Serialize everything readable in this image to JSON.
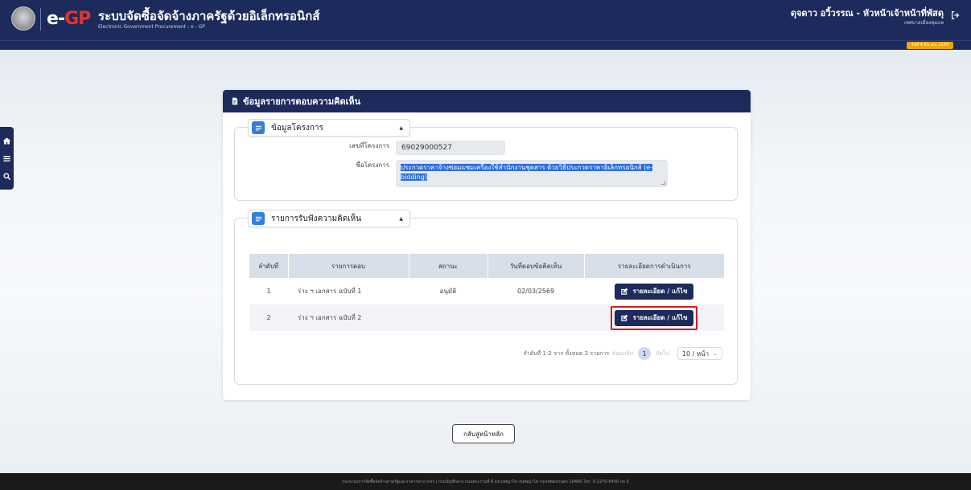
{
  "header": {
    "logo_text_e": "e-",
    "logo_text_gp": "GP",
    "system_title": "ระบบจัดซื้อจัดจ้างภาครัฐด้วยอิเล็กทรอนิกส์",
    "system_subtitle": "Electronic Government Procurement : e - GP",
    "user_name": "ดุจดาว อวิ้วรรณ - หัวหน้าเจ้าหน้าที่พัสดุ",
    "user_org": "เทศบาลเมืองชุมแพ",
    "date": "วันที่ 4 มีนาคม 2569"
  },
  "sidenav": {
    "icons": [
      "home-icon",
      "menu-icon",
      "search-icon"
    ]
  },
  "card": {
    "title": "ข้อมูลรายการตอบความคิดเห็น"
  },
  "project": {
    "legend": "ข้อมูลโครงการ",
    "project_no_label": "เลขที่โครงการ",
    "project_no_value": "69029000527",
    "project_name_label": "ชื่อโครงการ",
    "project_name_value": "ประกวดราคาจ้างซ่อมแซมเครื่องใช้สำนักงานชุดสาร ด้วยวิธีประกวดราคาอิเล็กทรอนิกส์ (e-bidding)"
  },
  "comments": {
    "legend": "รายการรับฟังความคิดเห็น",
    "columns": [
      "ลำดับที่",
      "รายการตอบ",
      "สถานะ",
      "วันที่ตอบข้อคิดเห็น",
      "รายละเอียดการดำเนินการ"
    ],
    "rows": [
      {
        "no": "1",
        "item": "ร่าง ฯ เอกสาร ฉบับที่ 1",
        "status": "อนุมัติ",
        "date": "02/03/2569",
        "action": "รายละเอียด / แก้ไข"
      },
      {
        "no": "2",
        "item": "ร่าง ฯ เอกสาร ฉบับที่ 2",
        "status": "",
        "date": "",
        "action": "รายละเอียด / แก้ไข"
      }
    ],
    "pager": {
      "summary": "ลำดับที่ 1-2 จาก ทั้งหมด 2 รายการ",
      "prev": "ย้อนกลับ",
      "page": "1",
      "next": "ถัดไป",
      "per_page": "10 / หน้า"
    }
  },
  "back_button": "กลับสู่หน้าหลัก",
  "footer": "กองระบบการจัดซื้อจัดจ้างภาครัฐและราคากลาง (กจร.) กรมบัญชีกลาง ถนนพระรามที่ 6 แขวงพญาไท เขตพญาไท กรุงเทพมหานคร 10400 โทร. 0-2270-6400 กด 3",
  "colors": {
    "navy": "#1c2a5c",
    "accent_blue": "#2f7fe0",
    "highlight_red": "#d91a1a",
    "badge_orange": "#f2a400"
  }
}
